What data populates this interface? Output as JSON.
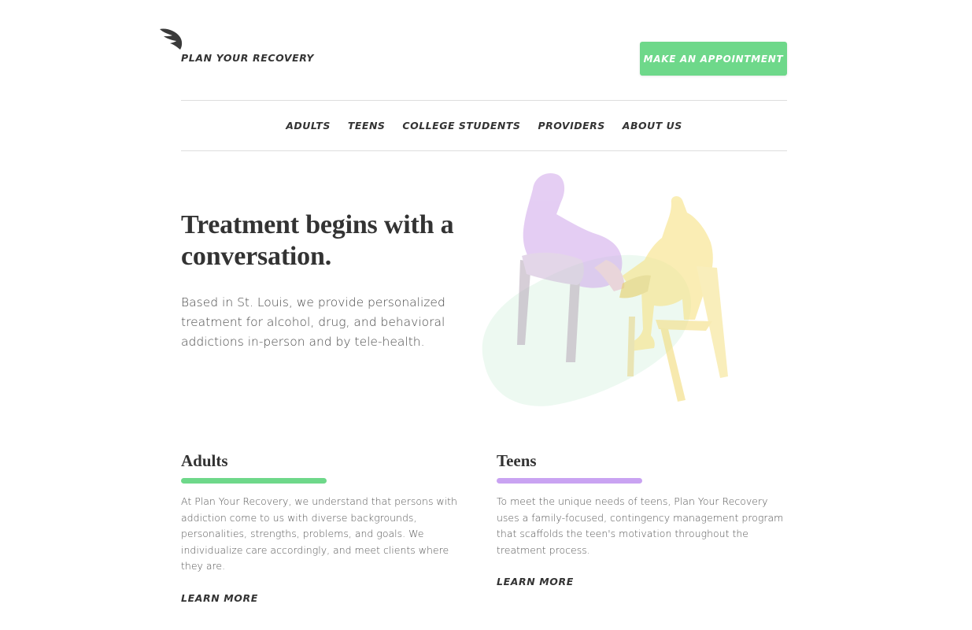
{
  "header": {
    "brand": "PLAN YOUR RECOVERY",
    "logo_icon": "wing-icon",
    "cta_label": "MAKE AN APPOINTMENT"
  },
  "nav": {
    "items": [
      "ADULTS",
      "TEENS",
      "COLLEGE STUDENTS",
      "PROVIDERS",
      "ABOUT US"
    ]
  },
  "hero": {
    "title": "Treatment begins with a conversation.",
    "text": "Based in St. Louis, we provide personalized treatment for alcohol, drug, and behavioral addictions in-person and by tele-health."
  },
  "cards": [
    {
      "title": "Adults",
      "text": "At Plan Your Recovery, we understand that persons with addiction come to us with diverse backgrounds, personalities, strengths, problems, and goals. We individualize care accordingly, and meet clients where they are.",
      "link": "LEARN MORE",
      "accent": "#6ed88a"
    },
    {
      "title": "Teens",
      "text": "To meet the unique needs of teens, Plan Your Recovery uses a family-focused, contingency management program that scaffolds the teen's motivation throughout the treatment process.",
      "link": "LEARN MORE",
      "accent": "#c9a3f2"
    }
  ],
  "colors": {
    "primary_green": "#6ed88a",
    "accent_purple": "#c9a3f2",
    "text_dark": "#333333",
    "illustration_yellow": "#f9e27d"
  }
}
